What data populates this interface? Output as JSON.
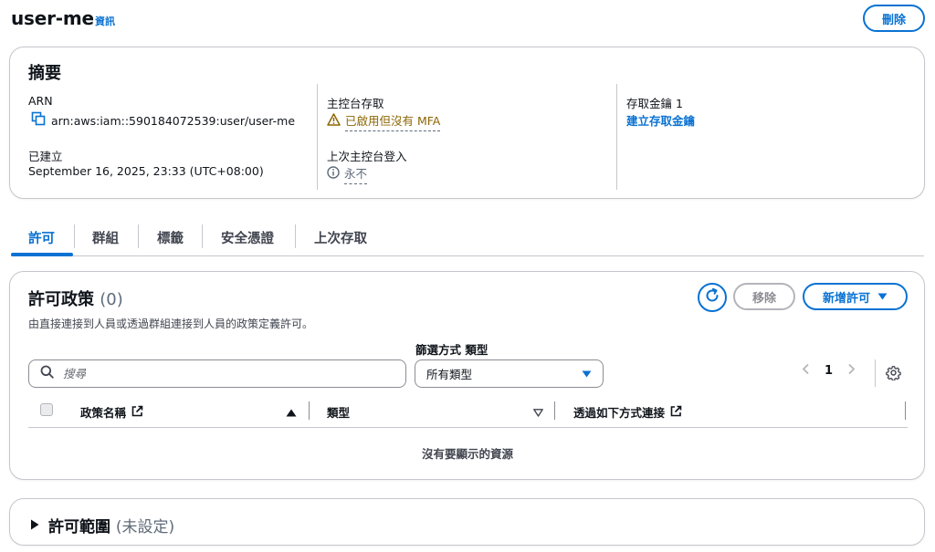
{
  "header": {
    "title": "user-me",
    "info_label": "資訊",
    "delete_label": "刪除"
  },
  "summary": {
    "title": "摘要",
    "arn_label": "ARN",
    "arn_value": "arn:aws:iam::590184072539:user/user-me",
    "created_label": "已建立",
    "created_value": "September 16, 2025, 23:33 (UTC+08:00)",
    "console_access_label": "主控台存取",
    "console_access_value": "已啟用但沒有 MFA",
    "last_login_label": "上次主控台登入",
    "last_login_value": "永不",
    "access_key_label": "存取金鑰 1",
    "create_access_key_link": "建立存取金鑰"
  },
  "tabs": [
    {
      "label": "許可",
      "active": true
    },
    {
      "label": "群組",
      "active": false
    },
    {
      "label": "標籤",
      "active": false
    },
    {
      "label": "安全憑證",
      "active": false
    },
    {
      "label": "上次存取",
      "active": false
    }
  ],
  "permissions": {
    "title": "許可政策",
    "count": "(0)",
    "description": "由直接連接到人員或透過群組連接到人員的政策定義許可。",
    "remove_label": "移除",
    "add_label": "新增許可",
    "filter_label": "篩選方式 類型",
    "search_placeholder": "搜尋",
    "type_select_value": "所有類型",
    "page_number": "1",
    "columns": [
      "政策名稱",
      "類型",
      "透過如下方式連接"
    ],
    "empty_message": "沒有要顯示的資源"
  },
  "boundary": {
    "title": "許可範圍",
    "status": "(未設定)"
  },
  "colors": {
    "accent": "#0972d3",
    "warning": "#8d6605",
    "border": "#c6c6cd"
  }
}
